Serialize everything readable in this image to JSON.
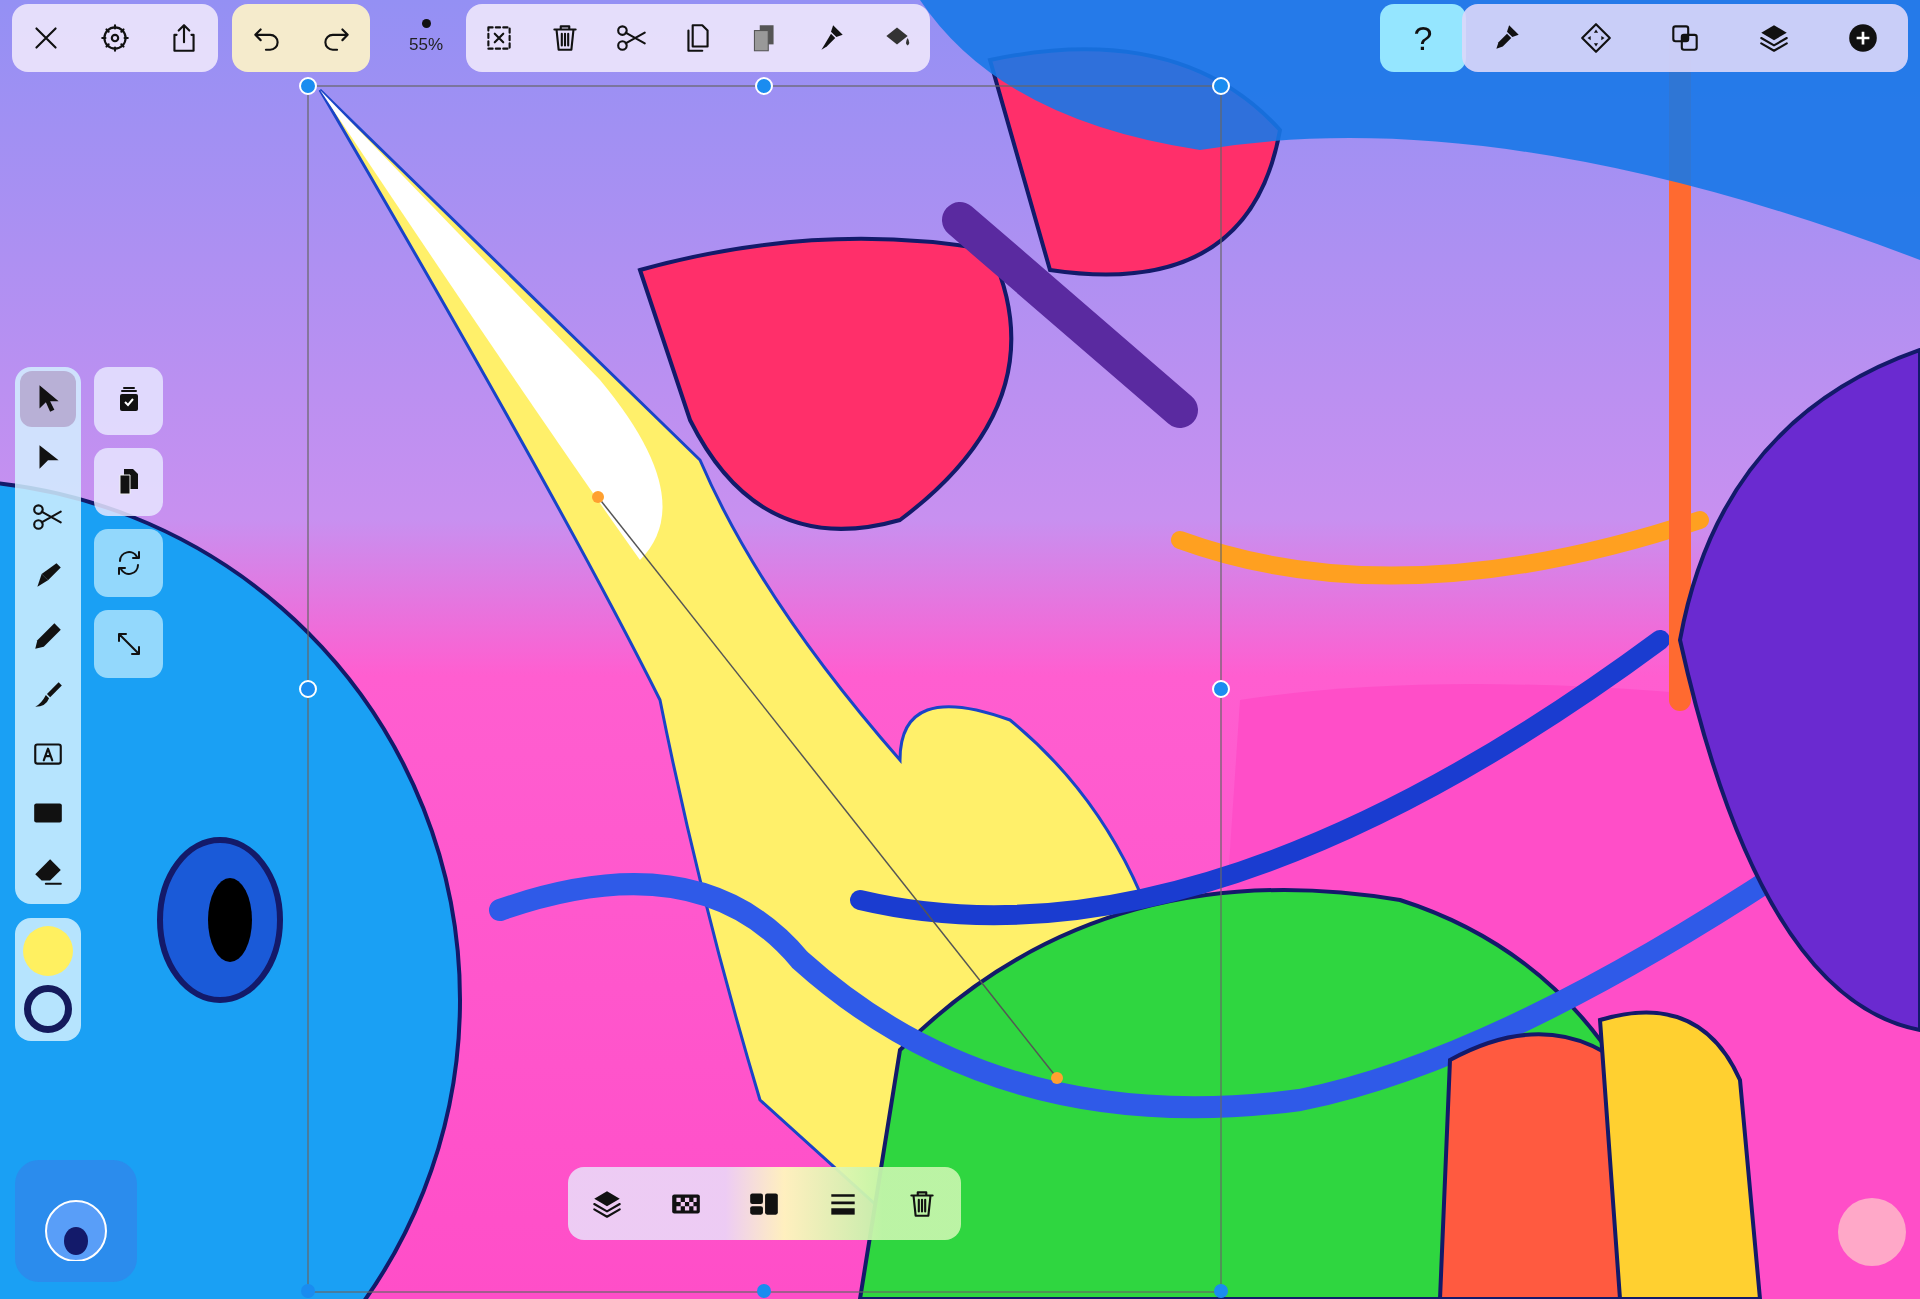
{
  "top_toolbar": {
    "zoom": "55%",
    "help": "?"
  },
  "tools": [
    {
      "kind": "select",
      "selected": true
    },
    {
      "kind": "direct",
      "selected": false
    },
    {
      "kind": "scissors",
      "selected": false
    },
    {
      "kind": "pen",
      "selected": false
    },
    {
      "kind": "pencil",
      "selected": false
    },
    {
      "kind": "brush",
      "selected": false
    },
    {
      "kind": "text",
      "selected": false
    },
    {
      "kind": "shape",
      "selected": false
    },
    {
      "kind": "eraser",
      "selected": false
    }
  ],
  "swatches": [
    {
      "kind": "fill",
      "color": "#fff060"
    },
    {
      "kind": "stroke",
      "color": "#141a5c"
    }
  ]
}
